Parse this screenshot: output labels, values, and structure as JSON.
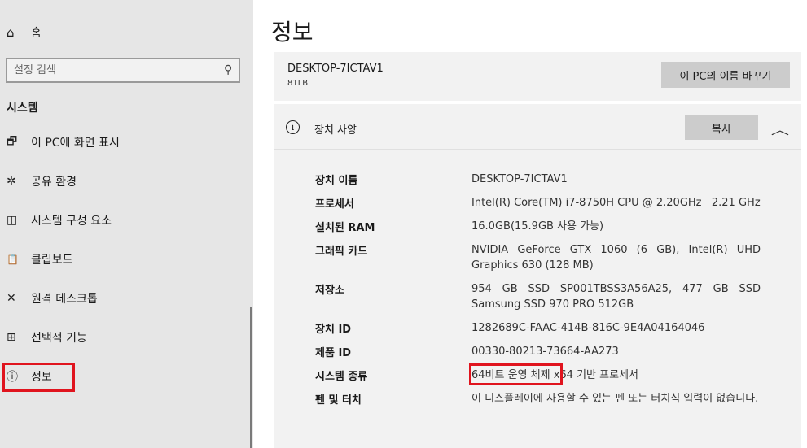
{
  "sidebar": {
    "home_icon": "home-icon",
    "home_label": "홈",
    "search_placeholder": "설정 검색",
    "section_title": "시스템",
    "items": [
      {
        "icon": "display-icon",
        "glyph": "🗗",
        "label": "이 PC에 화면 표시"
      },
      {
        "icon": "shared-experiences-icon",
        "glyph": "✲",
        "label": "공유 환경"
      },
      {
        "icon": "system-components-icon",
        "glyph": "◫",
        "label": "시스템 구성 요소"
      },
      {
        "icon": "clipboard-icon",
        "glyph": "📋",
        "label": "클립보드"
      },
      {
        "icon": "remote-desktop-icon",
        "glyph": "✕",
        "label": "원격 데스크톱"
      },
      {
        "icon": "optional-features-icon",
        "glyph": "⊞",
        "label": "선택적 기능"
      },
      {
        "icon": "info-icon",
        "glyph": "ⓘ",
        "label": "정보"
      }
    ]
  },
  "main": {
    "title": "정보",
    "pc_name": "DESKTOP-7ICTAV1",
    "pc_model": "81LB",
    "rename_button": "이 PC의 이름 바꾸기",
    "spec_section_title": "장치 사양",
    "copy_button": "복사",
    "specs": [
      {
        "label": "장치 이름",
        "value": "DESKTOP-7ICTAV1"
      },
      {
        "label": "프로세서",
        "value": "Intel(R) Core(TM) i7-8750H CPU @ 2.20GHz   2.21 GHz"
      },
      {
        "label": "설치된 RAM",
        "value": "16.0GB(15.9GB 사용 가능)"
      },
      {
        "label": "그래픽 카드",
        "value": "NVIDIA GeForce GTX 1060 (6 GB), Intel(R) UHD Graphics 630 (128 MB)"
      },
      {
        "label": "저장소",
        "value": "954 GB SSD SP001TBSS3A56A25, 477 GB SSD Samsung SSD 970 PRO 512GB"
      },
      {
        "label": "장치 ID",
        "value": "1282689C-FAAC-414B-816C-9E4A04164046"
      },
      {
        "label": "제품 ID",
        "value": "00330-80213-73664-AA273"
      },
      {
        "label": "시스템 종류",
        "value_highlight": "64비트 운영 체제",
        "value_rest": " x64 기반 프로세서"
      },
      {
        "label": "펜 및 터치",
        "value": "이 디스플레이에 사용할 수 있는 펜 또는 터치식 입력이 없습니다."
      }
    ]
  },
  "colors": {
    "sidebar_bg": "#e6e6e6",
    "card_bg": "#f2f2f2",
    "button_bg": "#cccccc",
    "highlight_box": "#e0141e"
  }
}
